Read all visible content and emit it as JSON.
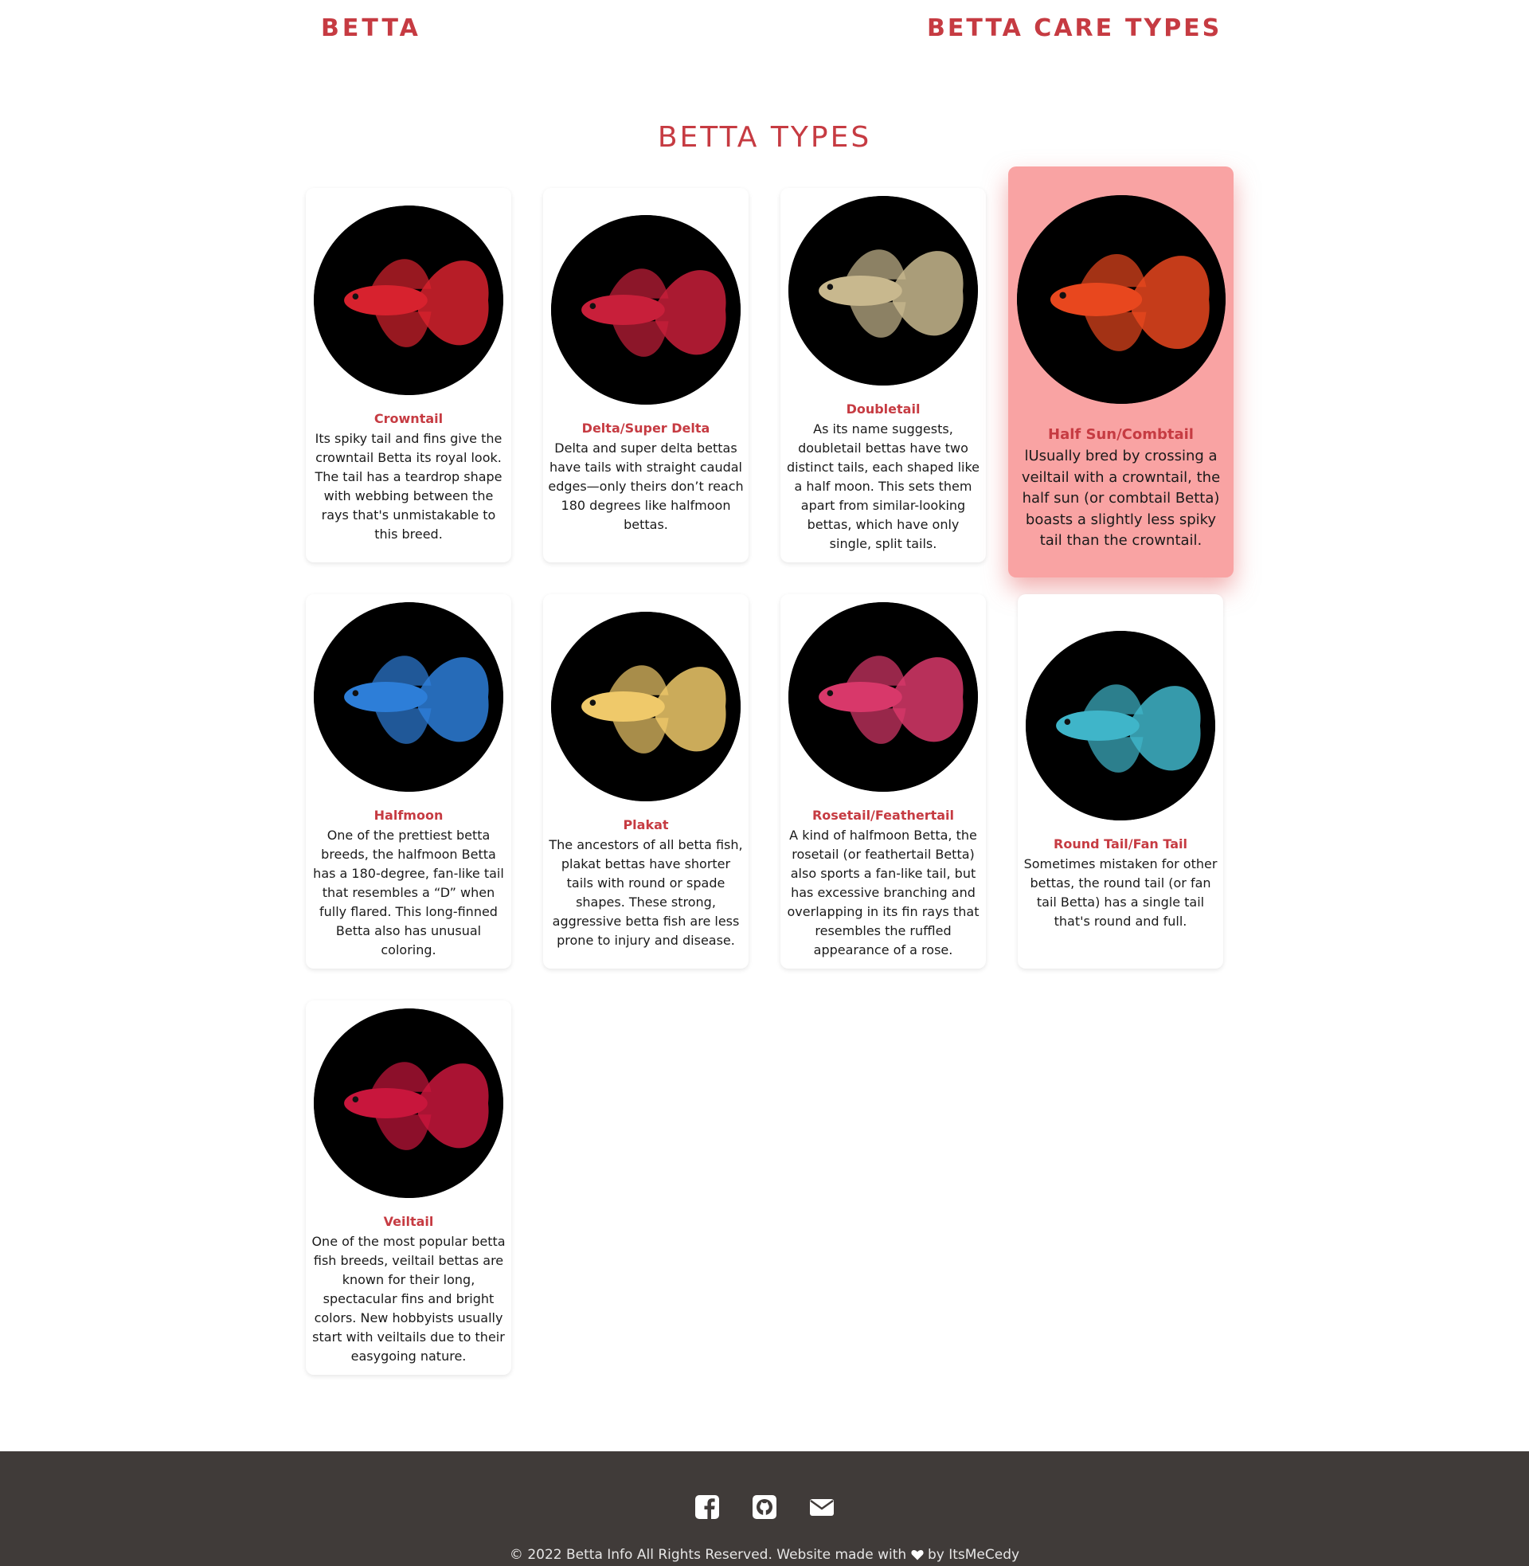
{
  "header": {
    "logo": "BETTA",
    "nav": [
      {
        "label": "BETTA CARE"
      },
      {
        "label": "TYPES"
      }
    ]
  },
  "main": {
    "title": "BETTA TYPES",
    "cards": [
      {
        "title": "Crowntail",
        "desc": "Its spiky tail and fins give the crowntail Betta its royal look. The tail has a teardrop shape with webbing between the rays that's unmistakable to this breed.",
        "fish_color": "#d7222e"
      },
      {
        "title": "Delta/Super Delta",
        "desc": "Delta and super delta bettas have tails with straight caudal edges—only theirs don’t reach 180 degrees like halfmoon bettas.",
        "fish_color": "#c81f3a"
      },
      {
        "title": "Doubletail",
        "desc": "As its name suggests, doubletail bettas have two distinct tails, each shaped like a half moon. This sets them apart from similar-looking bettas, which have only single, split tails.",
        "fish_color": "#c8b88e"
      },
      {
        "title": "Half Sun/Combtail",
        "desc": "lUsually bred by crossing a veiltail with a crowntail, the half sun (or combtail Betta) boasts a slightly less spiky tail than the crowntail.",
        "fish_color": "#e8471e"
      },
      {
        "title": "Halfmoon",
        "desc": "One of the prettiest betta breeds, the halfmoon Betta has a 180-degree, fan-like tail that resembles a “D” when fully flared. This long-finned Betta also has unusual coloring.",
        "fish_color": "#2d7ed8"
      },
      {
        "title": "Plakat",
        "desc": "The ancestors of all betta fish, plakat bettas have shorter tails with round or spade shapes. These strong, aggressive betta fish are less prone to injury and disease.",
        "fish_color": "#efc96a"
      },
      {
        "title": "Rosetail/Feathertail",
        "desc": "A kind of halfmoon Betta, the rosetail (or feathertail Betta) also sports a fan-like tail, but has excessive branching and overlapping in its fin rays that resembles the ruffled appearance of a rose.",
        "fish_color": "#d8386a"
      },
      {
        "title": "Round Tail/Fan Tail",
        "desc": "Sometimes mistaken for other bettas, the round tail (or fan tail Betta) has a single tail that's round and full.",
        "fish_color": "#3fb5c9"
      },
      {
        "title": "Veiltail",
        "desc": "One of the most popular betta fish breeds, veiltail bettas are known for their long, spectacular fins and bright colors. New hobbyists usually start with veiltails due to their easygoing nature.",
        "fish_color": "#c8163c"
      }
    ]
  },
  "footer": {
    "icons": [
      "facebook-icon",
      "github-icon",
      "email-icon"
    ],
    "text_before": "© 2022 Betta Info All Rights Reserved. Website made with",
    "text_after": "by ItsMeCedy"
  },
  "colors": {
    "accent": "#c63b42",
    "highlight_card": "#f9a3a3",
    "footer_bg": "#403b39"
  }
}
